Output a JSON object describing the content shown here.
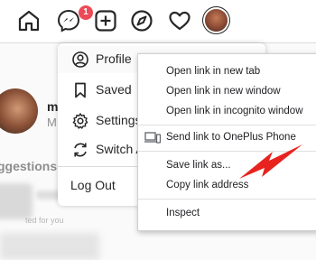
{
  "nav": {
    "notification_count": "1",
    "icons": [
      "home-icon",
      "messenger-icon",
      "new-post-icon",
      "explore-icon",
      "activity-heart-icon",
      "profile-avatar"
    ]
  },
  "page": {
    "post_name": "ma",
    "post_sub": "M",
    "suggestions_heading": "ggestions F",
    "suggested_for_you": "ted for you"
  },
  "profile_menu": {
    "items": [
      {
        "label": "Profile",
        "icon": "user-circle-icon"
      },
      {
        "label": "Saved",
        "icon": "bookmark-icon"
      },
      {
        "label": "Settings",
        "icon": "settings-gear-icon"
      },
      {
        "label": "Switch A",
        "icon": "switch-account-icon"
      }
    ],
    "logout": "Log Out"
  },
  "context_menu": {
    "open_new_tab": "Open link in new tab",
    "open_new_window": "Open link in new window",
    "open_incognito": "Open link in incognito window",
    "send_to_device": "Send link to OnePlus Phone",
    "save_link_as": "Save link as...",
    "copy_link_address": "Copy link address",
    "inspect": "Inspect"
  },
  "colors": {
    "badge": "#ed4956",
    "arrow": "#e8231f",
    "text": "#262626"
  }
}
